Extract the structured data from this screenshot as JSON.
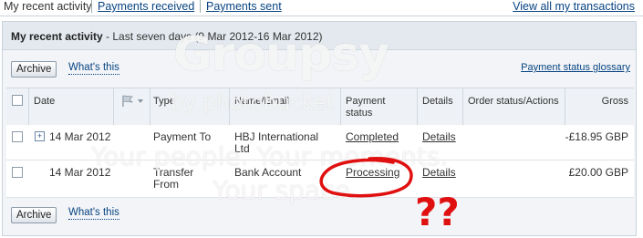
{
  "tabs": {
    "active": "My recent activity",
    "received": "Payments received",
    "sent": "Payments sent",
    "view_all": "View all my transactions"
  },
  "panel": {
    "title_bold": "My recent activity",
    "title_rest": " - Last seven days (9 Mar 2012-16 Mar 2012)",
    "archive_label": "Archive",
    "whats_this": "What's this",
    "glossary": "Payment status glossary"
  },
  "table": {
    "headers": {
      "date": "Date",
      "type": "Type",
      "name": "Name/Email",
      "status1": "Payment",
      "status2": "status",
      "details": "Details",
      "order": "Order status/Actions",
      "gross": "Gross"
    },
    "rows": [
      {
        "date": "14 Mar 2012",
        "type": "Payment To",
        "type2": "",
        "name": "HBJ International",
        "name2": "Ltd",
        "status": "Completed",
        "details": "Details",
        "gross": "-£18.95 GBP"
      },
      {
        "date": "14 Mar 2012",
        "type": "Transfer",
        "type2": "From",
        "name": "Bank Account",
        "name2": "",
        "status": "Processing",
        "details": "Details",
        "gross": "£20.00 GBP"
      }
    ]
  },
  "watermark": {
    "logo": "Groupsy",
    "by": "by photobucket",
    "tagline1": "Your people. Your moments.",
    "tagline2": "Your space."
  },
  "annotation": "??",
  "colors": {
    "link": "#084482",
    "annotation": "#e01010"
  }
}
